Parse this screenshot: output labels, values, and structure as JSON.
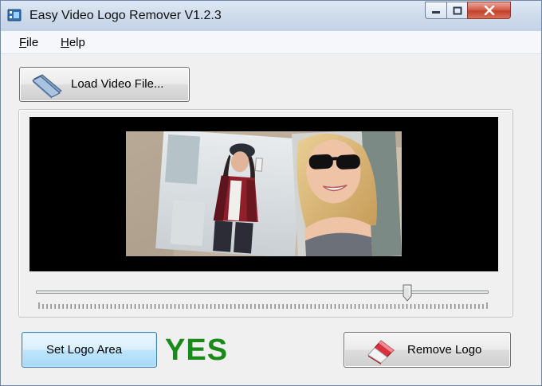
{
  "window": {
    "title": "Easy Video Logo Remover V1.2.3",
    "icons": {
      "app": "film-icon",
      "minimize": "minimize-icon",
      "maximize": "maximize-icon",
      "close": "close-icon"
    }
  },
  "menu": [
    {
      "label": "File",
      "accel": "F",
      "rest": "ile"
    },
    {
      "label": "Help",
      "accel": "H",
      "rest": "elp"
    }
  ],
  "toolbar": {
    "load_label": "Load Video File...",
    "load_icon": "folder-icon"
  },
  "video": {
    "preview": "video-frame-preview",
    "slider_position": 0.82
  },
  "bottom": {
    "set_logo_label": "Set Logo Area",
    "status_text": "YES",
    "status_color": "#1a8a1a",
    "remove_label": "Remove Logo",
    "remove_icon": "eraser-icon"
  },
  "colors": {
    "accent": "#3c7fb1",
    "close_red": "#c3432d",
    "video_bg": "#000000"
  }
}
